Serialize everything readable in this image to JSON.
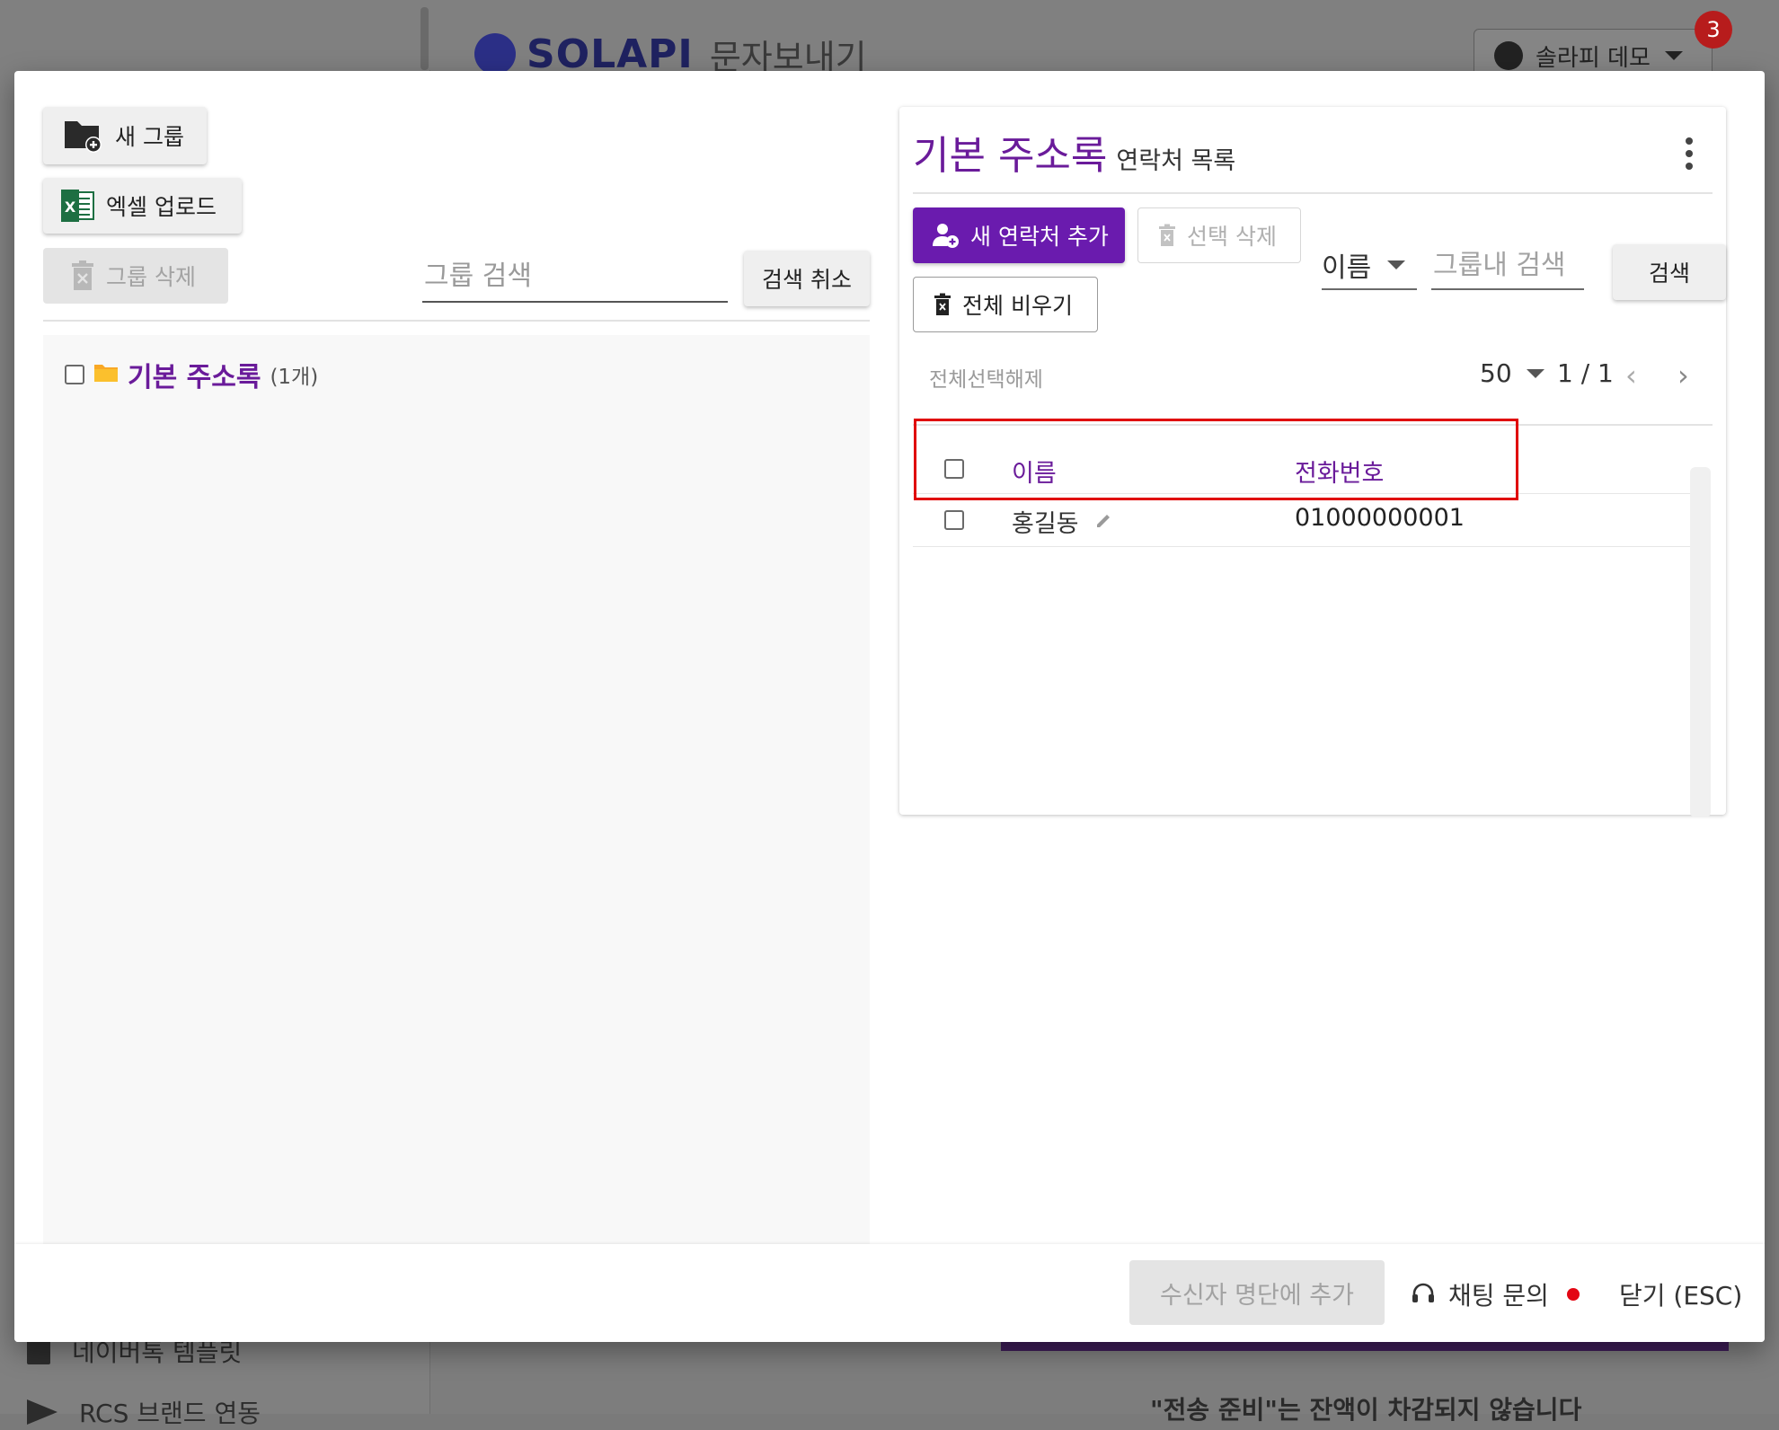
{
  "background": {
    "brand": "SOLAPI",
    "page_title": "문자보내기",
    "user_name": "솔라피 데모",
    "notification_count": "3",
    "nav_items": [
      "네이버톡 템플릿",
      "RCS 브랜드 연동"
    ],
    "footnote": "\"전송 준비\"는 잔액이 차감되지 않습니다"
  },
  "left": {
    "new_group": "새 그룹",
    "excel_upload": "엑셀 업로드",
    "delete_group": "그룹 삭제",
    "group_search_placeholder": "그룹 검색",
    "search_cancel": "검색 취소",
    "groups": [
      {
        "name": "기본 주소록",
        "count": "(1개)"
      }
    ]
  },
  "right": {
    "title": "기본 주소록",
    "subtitle": "연락처 목록",
    "add_contact": "새 연락처 추가",
    "delete_selected": "선택 삭제",
    "clear_all": "전체 비우기",
    "search_field_selected": "이름",
    "search_placeholder": "그룹내 검색",
    "search_button": "검색",
    "select_toggle": "전체선택해제",
    "page_size": "50",
    "page_info": "1 / 1",
    "columns": {
      "name": "이름",
      "phone": "전화번호"
    },
    "rows": [
      {
        "name": "홍길동",
        "phone": "01000000001"
      }
    ]
  },
  "footer": {
    "add_recipient": "수신자 명단에 추가",
    "chat": "채팅 문의",
    "close": "닫기 (ESC)"
  },
  "colors": {
    "accent": "#6a1b9a",
    "primary_button": "#6a1bae",
    "highlight": "#e00000",
    "chat_dot": "#e30613"
  },
  "icons": [
    "folder-plus-icon",
    "excel-icon",
    "trash-icon",
    "folder-icon",
    "person-add-icon",
    "pencil-icon",
    "headset-icon",
    "more-vertical-icon",
    "chevron-left-icon",
    "chevron-right-icon"
  ]
}
